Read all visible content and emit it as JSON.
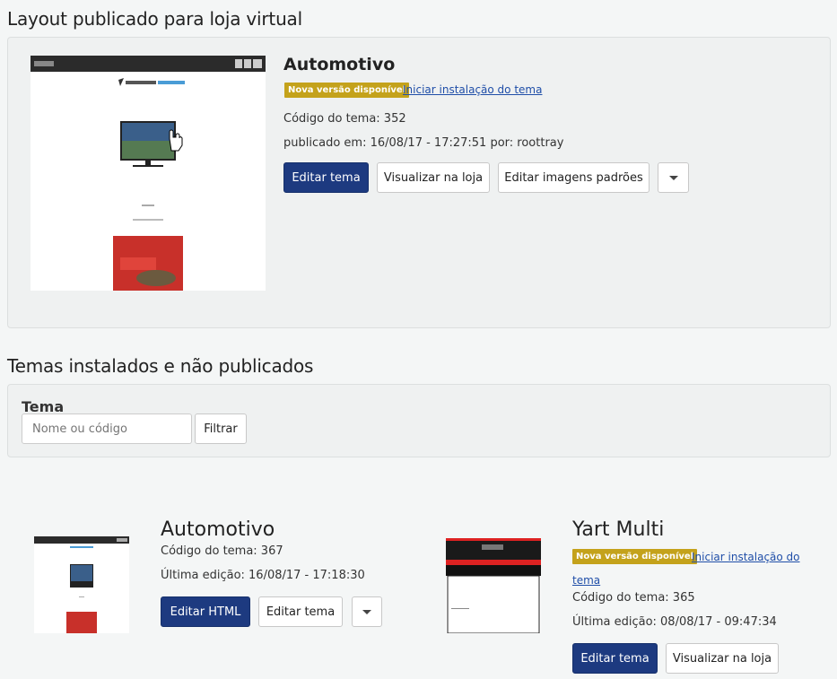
{
  "published": {
    "heading": "Layout publicado para loja virtual",
    "theme_name": "Automotivo",
    "badge": "Nova versão disponível",
    "install_link": "Iniciar instalação do tema",
    "code": "Código do tema: 352",
    "published_at": "publicado em: 16/08/17 - 17:27:51 por: roottray",
    "buttons": {
      "edit_theme": "Editar tema",
      "view_store": "Visualizar na loja",
      "edit_images": "Editar imagens padrões"
    }
  },
  "installed": {
    "heading": "Temas instalados e não publicados",
    "filter": {
      "label": "Tema",
      "placeholder": "Nome ou código",
      "button": "Filtrar"
    },
    "themes": [
      {
        "name": "Automotivo",
        "code": "Código do tema: 367",
        "last_edit": "Última edição: 16/08/17 - 17:18:30",
        "btn_primary": "Editar HTML",
        "btn_secondary": "Editar tema"
      },
      {
        "name": "Yart Multi",
        "badge": "Nova versão disponível",
        "install_link_a": "Iniciar instalação do",
        "install_link_b": "tema",
        "code": "Código do tema: 365",
        "last_edit": "Última edição: 08/08/17 - 09:47:34",
        "btn_primary": "Editar tema",
        "btn_secondary": "Visualizar na loja"
      }
    ]
  },
  "colors": {
    "primary": "#1d3a80",
    "badge": "#c4a21b",
    "link": "#1f4ea8"
  }
}
